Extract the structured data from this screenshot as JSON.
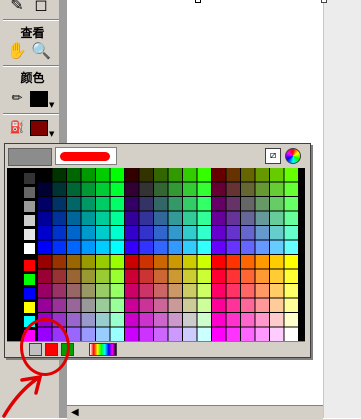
{
  "toolbar": {
    "view_label": "查看",
    "colors_label": "颜色",
    "tools": [
      {
        "icon": "eyedropper-icon",
        "glyph": "✎"
      },
      {
        "icon": "eraser-icon",
        "glyph": "◻"
      },
      {
        "icon": "hand-icon",
        "glyph": "✋"
      },
      {
        "icon": "zoom-icon",
        "glyph": "🔍"
      },
      {
        "icon": "pencil-icon",
        "glyph": "✏"
      },
      {
        "icon": "paint-bucket-icon",
        "glyph": "⛽"
      }
    ],
    "stroke_color": "#000000",
    "fill_color": "#800000"
  },
  "palette": {
    "preview_color": "#8c8c8c",
    "hex_value": "",
    "nocolor_glyph": "⧄",
    "recent_colors": [
      "#c0c0c0",
      "#ff0000",
      "#00a000"
    ],
    "gray_column": [
      "#333333",
      "#666666",
      "#999999",
      "#cccccc",
      "#e6e6e6",
      "#ffffff"
    ],
    "primary_column": [
      "#ff0000",
      "#00ff00",
      "#0000ff",
      "#ffff00",
      "#00ffff",
      "#ff00ff"
    ]
  },
  "colors": {
    "annotation": "#e00000",
    "toolbar_bg": "#d4d0c8"
  }
}
